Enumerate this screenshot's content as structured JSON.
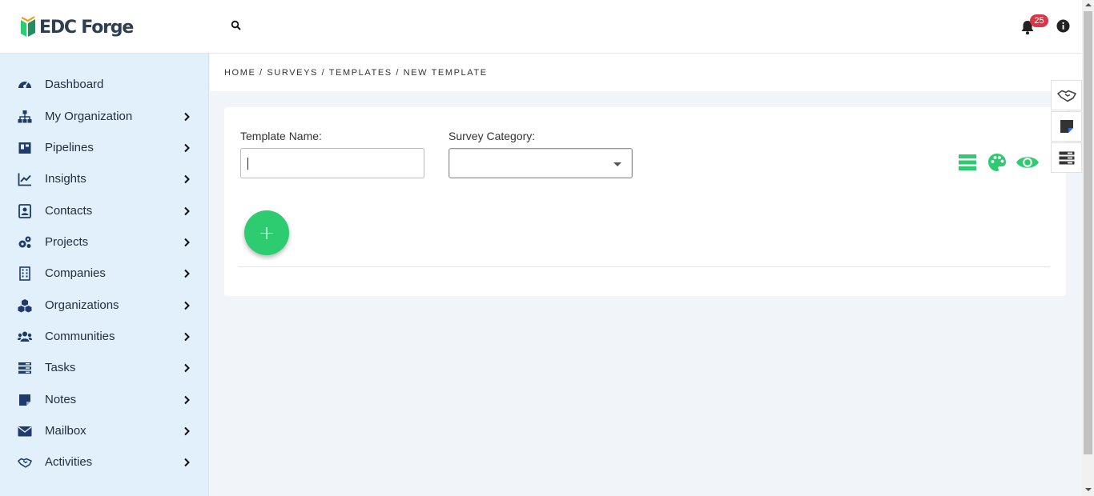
{
  "app": {
    "logo_text": "EDC Forge",
    "notifications_count": "25",
    "colors": {
      "accent_green": "#2ecc71",
      "sidebar_bg": "#e1f0fb",
      "badge_red": "#dc3545",
      "icon_navy": "#1f3a6b"
    }
  },
  "sidebar": {
    "items": [
      {
        "label": "Dashboard",
        "icon": "dashboard-icon",
        "has_submenu": false
      },
      {
        "label": "My Organization",
        "icon": "org-chart-icon",
        "has_submenu": true
      },
      {
        "label": "Pipelines",
        "icon": "pipeline-icon",
        "has_submenu": true
      },
      {
        "label": "Insights",
        "icon": "chart-line-icon",
        "has_submenu": true
      },
      {
        "label": "Contacts",
        "icon": "contact-card-icon",
        "has_submenu": true
      },
      {
        "label": "Projects",
        "icon": "gears-icon",
        "has_submenu": true
      },
      {
        "label": "Companies",
        "icon": "building-icon",
        "has_submenu": true
      },
      {
        "label": "Organizations",
        "icon": "cubes-icon",
        "has_submenu": true
      },
      {
        "label": "Communities",
        "icon": "users-icon",
        "has_submenu": true
      },
      {
        "label": "Tasks",
        "icon": "tasks-icon",
        "has_submenu": true
      },
      {
        "label": "Notes",
        "icon": "sticky-note-icon",
        "has_submenu": true
      },
      {
        "label": "Mailbox",
        "icon": "envelope-icon",
        "has_submenu": true
      },
      {
        "label": "Activities",
        "icon": "handshake-icon",
        "has_submenu": true
      }
    ]
  },
  "breadcrumb": "HOME / SURVEYS / TEMPLATES / NEW TEMPLATE",
  "form": {
    "template_name_label": "Template Name:",
    "template_name_value": "",
    "survey_category_label": "Survey Category:",
    "survey_category_value": ""
  },
  "toolbar": {
    "icons": [
      "list-layout-icon",
      "palette-icon",
      "eye-icon"
    ]
  },
  "fab": {
    "label": "+"
  },
  "float_panel": {
    "icons": [
      "handshake-icon",
      "sticky-note-icon",
      "tasks-icon"
    ]
  }
}
